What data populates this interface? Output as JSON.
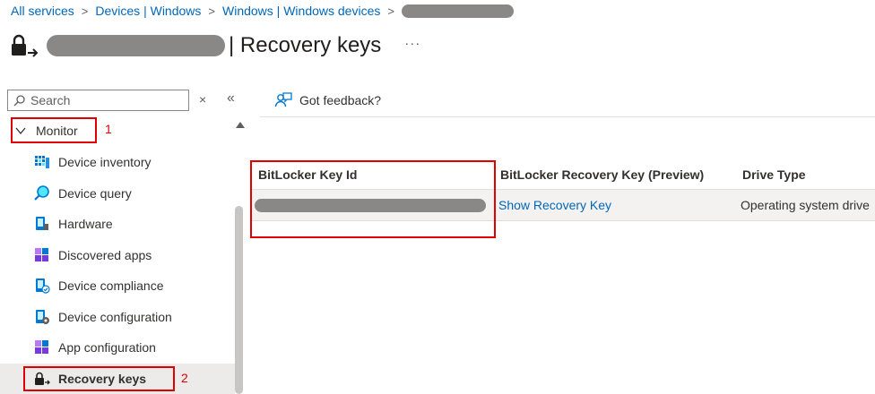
{
  "breadcrumb": {
    "items": [
      "All services",
      "Devices | Windows",
      "Windows | Windows devices"
    ],
    "separator": ">"
  },
  "header": {
    "title": "| Recovery keys",
    "more": "···"
  },
  "search": {
    "placeholder": "Search",
    "clear_icon": "×",
    "collapse_icon": "«"
  },
  "nav": {
    "group_label": "Monitor",
    "items": [
      {
        "label": "Device inventory",
        "icon": "device-inventory-icon"
      },
      {
        "label": "Device query",
        "icon": "device-query-icon"
      },
      {
        "label": "Hardware",
        "icon": "hardware-icon"
      },
      {
        "label": "Discovered apps",
        "icon": "discovered-apps-icon"
      },
      {
        "label": "Device compliance",
        "icon": "device-compliance-icon"
      },
      {
        "label": "Device configuration",
        "icon": "device-configuration-icon"
      },
      {
        "label": "App configuration",
        "icon": "app-configuration-icon"
      },
      {
        "label": "Recovery keys",
        "icon": "recovery-keys-icon",
        "active": true
      }
    ]
  },
  "toolbar": {
    "feedback_label": "Got feedback?"
  },
  "table": {
    "columns": [
      "BitLocker Key Id",
      "BitLocker Recovery Key (Preview)",
      "Drive Type"
    ],
    "rows": [
      {
        "key_id": "",
        "recovery_key": "Show Recovery Key",
        "drive_type": "Operating system drive"
      }
    ]
  },
  "annotations": {
    "one": "1",
    "two": "2"
  },
  "colors": {
    "link": "#0067b8",
    "highlight": "#e00000",
    "active_row": "#edebe9",
    "redaction": "#8a8886"
  }
}
